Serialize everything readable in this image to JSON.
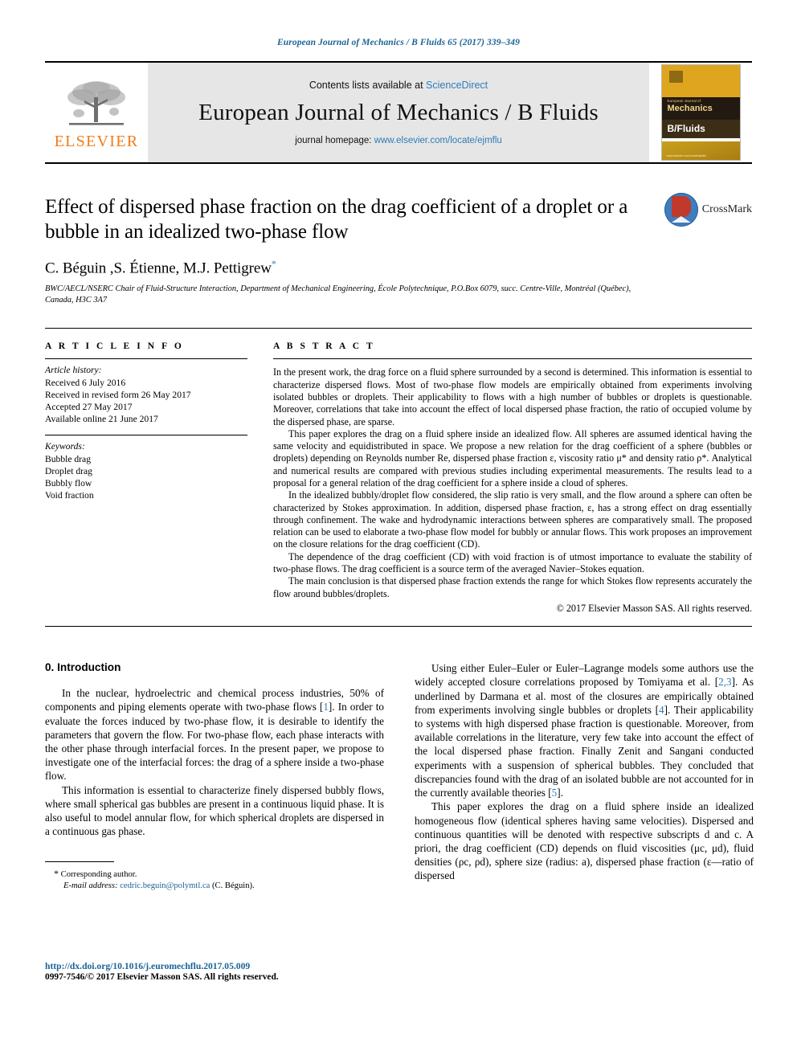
{
  "running_head": "European Journal of Mechanics / B Fluids 65 (2017) 339–349",
  "masthead": {
    "publisher_logo_label": "ELSEVIER",
    "contents_prefix": "Contents lists available at",
    "contents_link": "ScienceDirect",
    "journal_title": "European Journal of Mechanics / B Fluids",
    "homepage_prefix": "journal homepage:",
    "homepage_link": "www.elsevier.com/locate/ejmflu",
    "cover": {
      "line1": "European Journal of",
      "line2": "Mechanics",
      "line3": "B/Fluids",
      "footer": "www.elsevier.com/locate/ejmflu"
    }
  },
  "article": {
    "title": "Effect of dispersed phase fraction on the drag coefficient of a droplet or a bubble in an idealized two-phase flow",
    "authors": "C. Béguin ,S. Étienne, M.J. Pettigrew",
    "author_marker": "*",
    "affiliation": "BWC/AECL/NSERC Chair of Fluid-Structure Interaction, Department of Mechanical Engineering, École Polytechnique, P.O.Box 6079, succ. Centre-Ville, Montréal (Québec), Canada, H3C 3A7",
    "crossmark_label": "CrossMark"
  },
  "article_info": {
    "heading": "A R T I C L E    I N F O",
    "history_label": "Article history:",
    "history": [
      "Received 6 July 2016",
      "Received in revised form 26 May 2017",
      "Accepted 27 May 2017",
      "Available online 21 June 2017"
    ],
    "keywords_label": "Keywords:",
    "keywords": [
      "Bubble drag",
      "Droplet drag",
      "Bubbly flow",
      "Void fraction"
    ]
  },
  "abstract": {
    "heading": "A B S T R A C T",
    "paragraphs": [
      "In the present work, the drag force on a fluid sphere surrounded by a second is determined. This information is essential to characterize dispersed flows. Most of two-phase flow models are empirically obtained from experiments involving isolated bubbles or droplets. Their applicability to flows with a high number of bubbles or droplets is questionable. Moreover, correlations that take into account the effect of local dispersed phase fraction, the ratio of occupied volume by the dispersed phase, are sparse.",
      "This paper explores the drag on a fluid sphere inside an idealized flow. All spheres are assumed identical having the same velocity and equidistributed in space. We propose a new relation for the drag coefficient of a sphere (bubbles or droplets) depending on Reynolds number Re, dispersed phase fraction ε, viscosity ratio μ* and density ratio ρ*. Analytical and numerical results are compared with previous studies including experimental measurements. The results lead to a proposal for a general relation of the drag coefficient for a sphere inside a cloud of spheres.",
      "In the idealized bubbly/droplet flow considered, the slip ratio is very small, and the flow around a sphere can often be characterized by Stokes approximation. In addition, dispersed phase fraction, ε, has a strong effect on drag essentially through confinement. The wake and hydrodynamic interactions between spheres are comparatively small. The proposed relation can be used to elaborate a two-phase flow model for bubbly or annular flows. This work proposes an improvement on the closure relations for the drag coefficient (CD).",
      "The dependence of the drag coefficient (CD) with void fraction is of utmost importance to evaluate the stability of two-phase flows. The drag coefficient is a source term of the averaged Navier–Stokes equation.",
      "The main conclusion is that dispersed phase fraction extends the range for which Stokes flow represents accurately the flow around bubbles/droplets."
    ],
    "copyright": "© 2017 Elsevier Masson SAS. All rights reserved."
  },
  "body": {
    "section_heading": "0. Introduction",
    "left_paragraphs": [
      "In the nuclear, hydroelectric and chemical process industries, 50% of components and piping elements operate with two-phase flows [1]. In order to evaluate the forces induced by two-phase flow, it is desirable to identify the parameters that govern the flow. For two-phase flow, each phase interacts with the other phase through interfacial forces. In the present paper, we propose to investigate one of the interfacial forces: the drag of a sphere inside a two-phase flow.",
      "This information is essential to characterize finely dispersed bubbly flows, where small spherical gas bubbles are present in a continuous liquid phase. It is also useful to model annular flow, for which spherical droplets are dispersed in a continuous gas phase."
    ],
    "right_paragraphs": [
      "Using either Euler–Euler or Euler–Lagrange models some authors use the widely accepted closure correlations proposed by Tomiyama et al. [2,3]. As underlined by Darmana et al. most of the closures are empirically obtained from experiments involving single bubbles or droplets [4]. Their applicability to systems with high dispersed phase fraction is questionable. Moreover, from available correlations in the literature, very few take into account the effect of the local dispersed phase fraction. Finally Zenit and Sangani conducted experiments with a suspension of spherical bubbles. They concluded that discrepancies found with the drag of an isolated bubble are not accounted for in the currently available theories [5].",
      "This paper explores the drag on a fluid sphere inside an idealized homogeneous flow (identical spheres having same velocities). Dispersed and continuous quantities will be denoted with respective subscripts d and c. A priori, the drag coefficient (CD) depends on fluid viscosities (μc, μd), fluid densities (ρc, ρd), sphere size (radius: a), dispersed phase fraction (ε—ratio of dispersed"
    ]
  },
  "footnote": {
    "corresponding": "Corresponding author.",
    "email_label": "E-mail address:",
    "email": "cedric.beguin@polymtl.ca",
    "email_suffix": "(C. Béguin)."
  },
  "footer": {
    "doi": "http://dx.doi.org/10.1016/j.euromechflu.2017.05.009",
    "issn_line": "0997-7546/© 2017 Elsevier Masson SAS. All rights reserved."
  },
  "colors": {
    "link": "#2e7cb8",
    "running_head": "#1a6496",
    "elsevier_orange": "#ef7c16",
    "masthead_bg": "#e6e6e6"
  }
}
